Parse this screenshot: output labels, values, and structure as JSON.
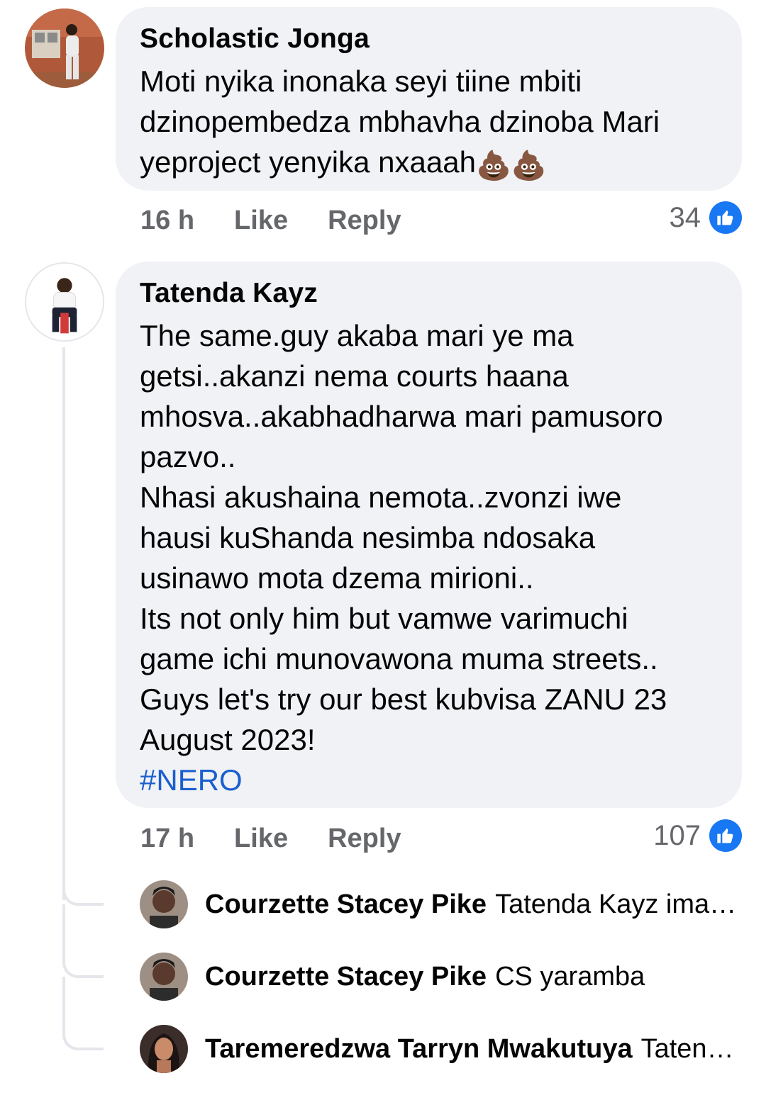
{
  "comments": [
    {
      "author": "Scholastic Jonga",
      "text": "Moti nyika inonaka seyi tiine mbiti\ndzinopembedza mbhavha dzinoba Mari\nyeproject yenyika nxaaah",
      "emoji": "💩💩",
      "time": "16 h",
      "like_label": "Like",
      "reply_label": "Reply",
      "reaction_count": "34",
      "reaction_icon": "like-icon"
    },
    {
      "author": "Tatenda Kayz",
      "text": "The same.guy akaba mari ye ma\ngetsi..akanzi nema courts haana\nmhosva..akabhadharwa mari pamusoro\npazvo..\nNhasi akushaina nemota..zvonzi iwe\nhausi kuShanda nesimba ndosaka\nusinawo mota dzema mirioni..\nIts not only him but vamwe varimuchi\ngame ichi munovawona muma streets..\nGuys let's try our best kubvisa ZANU 23\nAugust 2023!",
      "hashtag": "#NERO",
      "time": "17 h",
      "like_label": "Like",
      "reply_label": "Reply",
      "reaction_count": "107",
      "reaction_icon": "like-icon"
    }
  ],
  "replies": [
    {
      "author": "Courzette Stacey Pike",
      "snippet": "Tatenda Kayz imagi..."
    },
    {
      "author": "Courzette Stacey Pike",
      "snippet": "CS yaramba"
    },
    {
      "author": "Taremeredzwa Tarryn Mwakutuya",
      "snippet": "Tatend..."
    }
  ],
  "colors": {
    "bubble_bg": "#f0f2f5",
    "meta_text": "#65676b",
    "like_blue": "#1877f2",
    "hashtag": "#1b5fcf",
    "thread_line": "#e4e6eb"
  }
}
